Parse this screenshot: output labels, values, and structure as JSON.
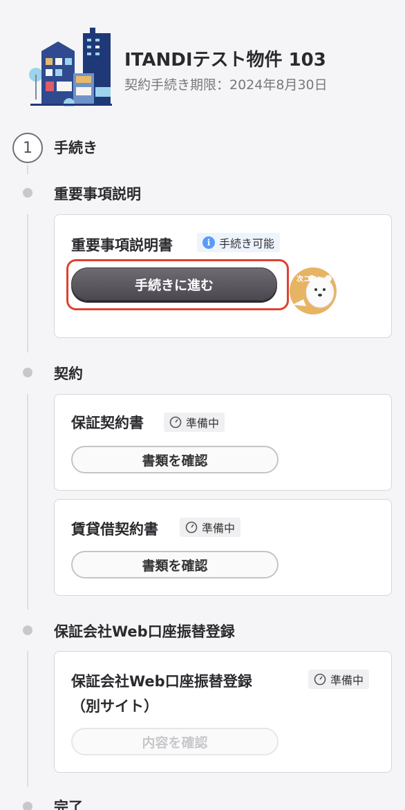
{
  "property": {
    "name": "ITANDIテスト物件 103",
    "deadline": "契約手続き期限：2024年8月30日"
  },
  "step": {
    "number": "1",
    "label": "手続き"
  },
  "sections": {
    "important": {
      "title": "重要事項説明",
      "card": {
        "title": "重要事項説明書",
        "badge": "手続き可能",
        "button": "手続きに進む",
        "mascot_text": "次ココ!"
      }
    },
    "contract": {
      "title": "契約",
      "cards": [
        {
          "title": "保証契約書",
          "badge": "準備中",
          "button": "書類を確認"
        },
        {
          "title": "賃貸借契約書",
          "badge": "準備中",
          "button": "書類を確認"
        }
      ]
    },
    "web": {
      "title": "保証会社Web口座振替登録",
      "card": {
        "title_line1": "保証会社Web口座振替登録",
        "title_line2": "（別サイト）",
        "badge": "準備中",
        "button": "内容を確認"
      }
    },
    "complete": {
      "title": "完了"
    }
  },
  "colors": {
    "primary_button": "#5a575f",
    "highlight": "#e0402e",
    "info": "#5a9bf5",
    "rail": "#dedee2"
  }
}
